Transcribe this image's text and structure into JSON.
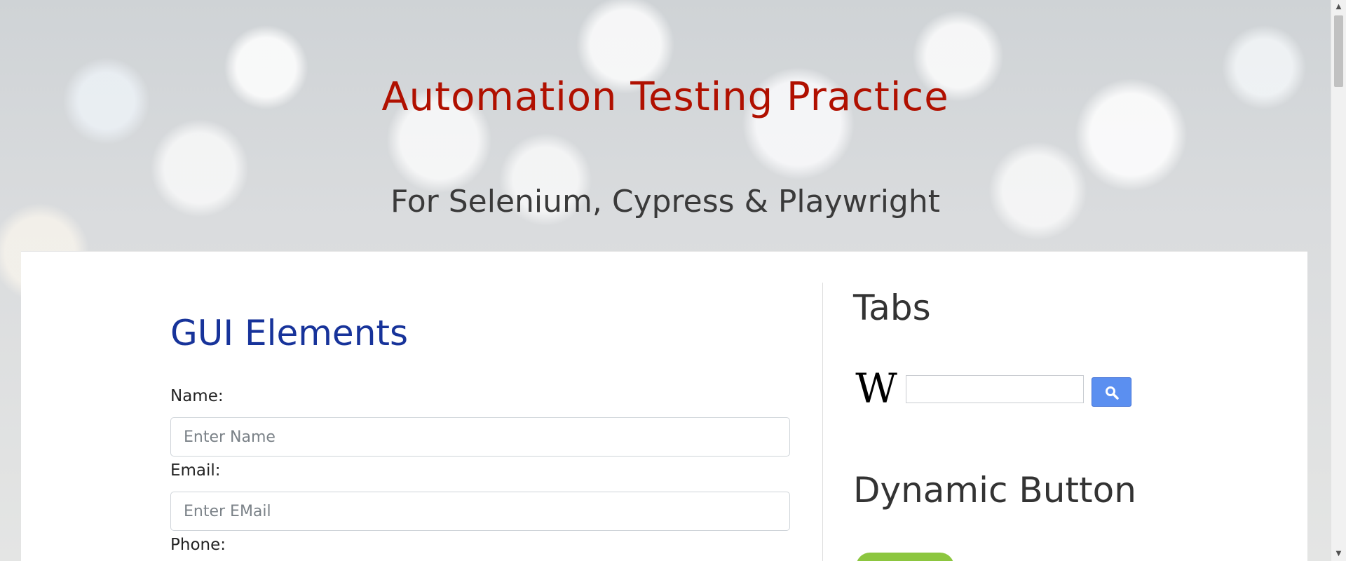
{
  "header": {
    "title": "Automation Testing Practice",
    "subtitle": "For Selenium, Cypress & Playwright"
  },
  "gui_section": {
    "heading": "GUI Elements",
    "name_label": "Name:",
    "name_placeholder": "Enter Name",
    "email_label": "Email:",
    "email_placeholder": "Enter EMail",
    "phone_label": "Phone:"
  },
  "tabs_section": {
    "heading": "Tabs",
    "logo_icon": "wikipedia-logo-icon",
    "search_button_icon": "search-icon"
  },
  "dynamic_section": {
    "heading": "Dynamic Button",
    "button_color": "#8cc63f"
  },
  "colors": {
    "title": "#b01000",
    "gui_heading": "#17339a",
    "search_button": "#5b8ff0"
  }
}
